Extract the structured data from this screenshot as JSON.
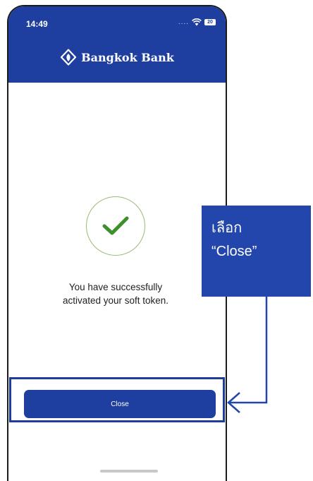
{
  "status_bar": {
    "time": "14:49",
    "signal_dots": "....",
    "battery_level": "20"
  },
  "header": {
    "brand_name": "Bangkok Bank",
    "background_color": "#1e3ea0"
  },
  "success": {
    "icon": "checkmark-icon",
    "message_line1": "You have successfully",
    "message_line2": "activated your soft token."
  },
  "actions": {
    "close_label": "Close"
  },
  "annotation": {
    "line1": "เลือก",
    "line2": "“Close”"
  },
  "colors": {
    "primary": "#1e3ea0",
    "check_green": "#3f8f2f",
    "circle_border": "#9aba74"
  }
}
